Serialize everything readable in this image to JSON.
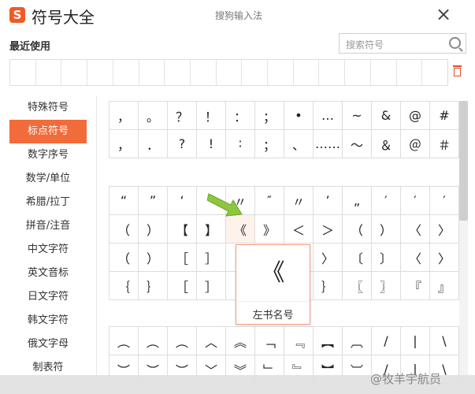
{
  "window": {
    "app_title": "符号大全",
    "center_title": "搜狗输入法",
    "close_symbol": "×"
  },
  "recent": {
    "label": "最近使用",
    "cells": 17
  },
  "search": {
    "placeholder": "搜索符号"
  },
  "sidebar": {
    "items": [
      {
        "label": "特殊符号",
        "active": false
      },
      {
        "label": "标点符号",
        "active": true
      },
      {
        "label": "数字序号",
        "active": false
      },
      {
        "label": "数学/单位",
        "active": false
      },
      {
        "label": "希腊/拉丁",
        "active": false
      },
      {
        "label": "拼音/注音",
        "active": false
      },
      {
        "label": "中文字符",
        "active": false
      },
      {
        "label": "英文音标",
        "active": false
      },
      {
        "label": "日文字符",
        "active": false
      },
      {
        "label": "韩文字符",
        "active": false
      },
      {
        "label": "俄文字母",
        "active": false
      },
      {
        "label": "制表符",
        "active": false
      }
    ]
  },
  "grids": [
    {
      "rows": [
        [
          "，",
          "。",
          "？",
          "！",
          "：",
          "；",
          "•",
          "…",
          "~",
          "&",
          "@",
          "#"
        ],
        [
          "，",
          "．",
          "?",
          "!",
          "∶",
          "；",
          "、",
          "……",
          "～",
          "＆",
          "＠",
          "＃"
        ]
      ]
    },
    {
      "rows": [
        [
          "“",
          "”",
          "‘",
          "’",
          "〃",
          "″",
          "〃",
          "’",
          "„",
          "′",
          "′",
          "′"
        ],
        [
          "（",
          "）",
          "【",
          "】",
          "《",
          "》",
          "＜",
          "＞",
          "（",
          "）",
          "〈",
          "〉"
        ],
        [
          "（",
          "）",
          "［",
          "］",
          "〈",
          "〉",
          "〈",
          "〉",
          "〔",
          "〕",
          "〈",
          "〉"
        ],
        [
          "｛",
          "｝",
          "［",
          "］",
          "「",
          "」",
          "｛",
          "｝",
          "〖",
          "〗",
          "『",
          "』"
        ]
      ]
    },
    {
      "rows": [
        [
          "︵",
          "︵",
          "︵",
          "︿",
          "︽",
          "﹁",
          "﹃",
          "︻",
          "︹",
          "/",
          "|",
          "\\"
        ],
        [
          "︶",
          "︶",
          "︶",
          "﹀",
          "︾",
          "﹂",
          "﹄",
          "︼",
          "︺",
          "/",
          "|",
          "\\"
        ]
      ]
    }
  ],
  "popup": {
    "symbol": "《",
    "name": "左书名号"
  },
  "watermark": "@牧羊宇航员",
  "colors": {
    "accent": "#f26b3a",
    "arrow": "#8dc63f"
  }
}
